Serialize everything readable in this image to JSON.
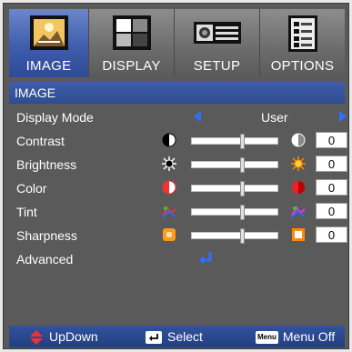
{
  "tabs": [
    {
      "label": "IMAGE",
      "icon": "image-icon",
      "active": true
    },
    {
      "label": "DISPLAY",
      "icon": "display-icon",
      "active": false
    },
    {
      "label": "SETUP",
      "icon": "setup-icon",
      "active": false
    },
    {
      "label": "OPTIONS",
      "icon": "options-icon",
      "active": false
    }
  ],
  "section_title": "IMAGE",
  "display_mode": {
    "label": "Display Mode",
    "value": "User"
  },
  "settings": {
    "contrast": {
      "label": "Contrast",
      "value": "0",
      "level": 0.58
    },
    "brightness": {
      "label": "Brightness",
      "value": "0",
      "level": 0.58
    },
    "color": {
      "label": "Color",
      "value": "0",
      "level": 0.58
    },
    "tint": {
      "label": "Tint",
      "value": "0",
      "level": 0.58
    },
    "sharpness": {
      "label": "Sharpness",
      "value": "0",
      "level": 0.58
    }
  },
  "advanced": {
    "label": "Advanced",
    "icon": "enter-icon"
  },
  "footer": {
    "updown": "UpDown",
    "select": "Select",
    "menu_key": "Menu",
    "menu_off": "Menu Off"
  },
  "colors": {
    "accent": "#2f6fff",
    "active_tab": "#3e5dad",
    "panel": "#5a5a5a"
  }
}
